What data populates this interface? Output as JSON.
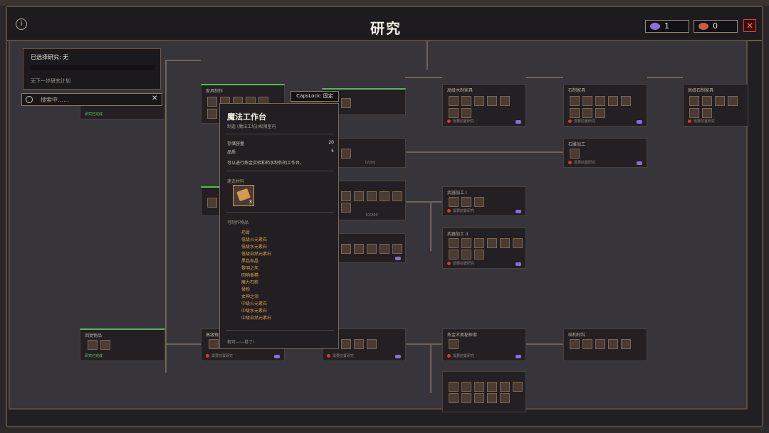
{
  "window": {
    "title": "研究"
  },
  "resources": [
    {
      "value": "1",
      "color": "#8b6fd9"
    },
    {
      "value": "0",
      "color": "#c85b4a"
    }
  ],
  "selection": {
    "title": "已选择研究: 无",
    "next": "无下一步研究计划"
  },
  "search": {
    "placeholder": "搜索中……"
  },
  "capslock": "CapsLock: 固定",
  "tooltip": {
    "title": "魔法工作台",
    "subtitle": "制造 (魔法工坊)/权限室内",
    "stats": [
      {
        "label": "存储容量",
        "value": "20"
      },
      {
        "label": "品质",
        "value": "5"
      }
    ],
    "description": "可以进行炼金实验和药水制作的工作台。",
    "materials_label": "建造材料",
    "material_qty": "3",
    "crafts_label": "可制作物品",
    "crafts": [
      "药膏",
      "低级火元素石",
      "低级水元素石",
      "低级自然元素石",
      "黑色血晶",
      "黎明之灰",
      "回响香精",
      "魔力石粉",
      "骨粉",
      "女神之泪",
      "中级火元素石",
      "中级水元素石",
      "中级自然元素石"
    ],
    "footer": "假可——卷了!"
  },
  "nodes": {
    "n1": "初级锻造",
    "n2": "家具制作",
    "n3": "高级木制家具",
    "n4": "石制家具",
    "n5": "高级石制家具",
    "n6": "石雕加工",
    "n7": "武器加工 I",
    "n8": "武器加工 II",
    "n9": "回复物品",
    "n10": "炼金术奥秘探索",
    "n11": "结构材料",
    "n12": "高级锻造",
    "progress_a": "0/200",
    "progress_b": "10/200",
    "req_text": "需要前置研究",
    "unlocked_text": "研究已完成"
  }
}
